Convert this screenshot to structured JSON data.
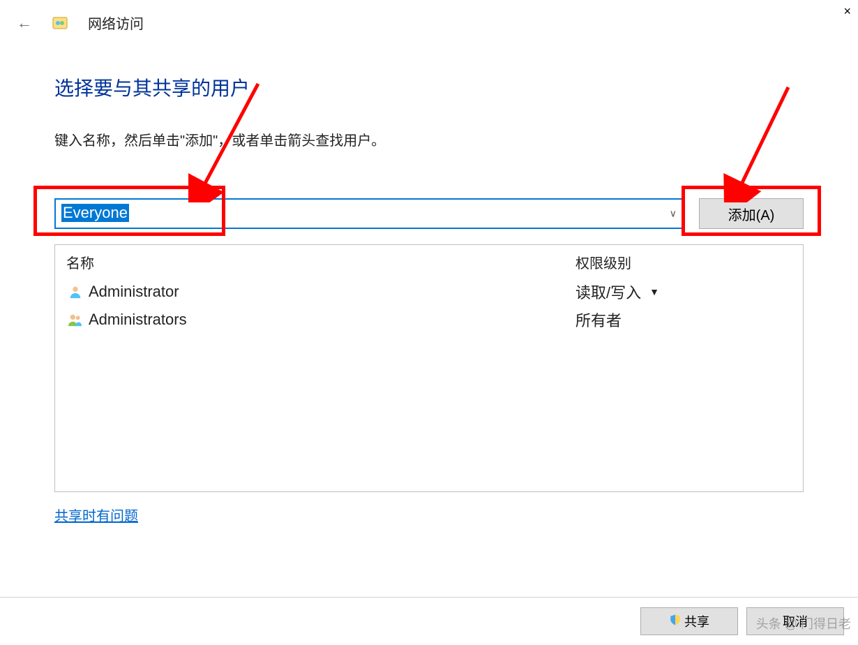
{
  "header": {
    "title": "网络访问"
  },
  "main": {
    "heading": "选择要与其共享的用户",
    "subtitle": "键入名称，然后单击\"添加\"，或者单击箭头查找用户。",
    "combo_value": "Everyone",
    "add_button": "添加(A)"
  },
  "list": {
    "col_name": "名称",
    "col_perm": "权限级别",
    "rows": [
      {
        "name": "Administrator",
        "perm": "读取/写入",
        "has_dropdown": true,
        "icon": "user"
      },
      {
        "name": "Administrators",
        "perm": "所有者",
        "has_dropdown": false,
        "icon": "group"
      }
    ]
  },
  "help_link": "共享时有问题",
  "footer": {
    "share_button": "共享",
    "cancel_button": "取消"
  },
  "watermark": "头条 @ 门得日老"
}
